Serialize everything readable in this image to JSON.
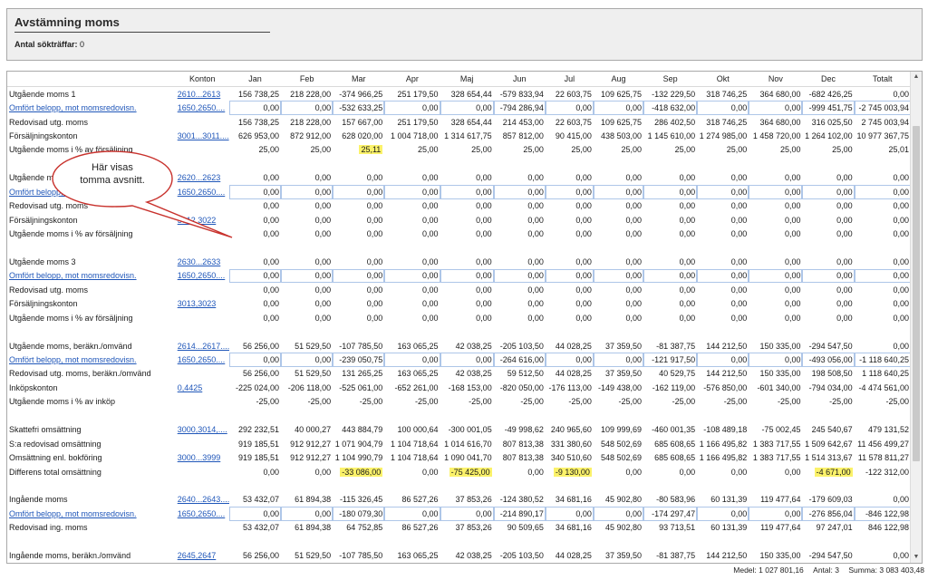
{
  "header": {
    "title": "Avstämning moms",
    "hits_label": "Antal sökträffar:",
    "hits_value": "0"
  },
  "columns": [
    "",
    "Konton",
    "Jan",
    "Feb",
    "Mar",
    "Apr",
    "Maj",
    "Jun",
    "Jul",
    "Aug",
    "Sep",
    "Okt",
    "Nov",
    "Dec",
    "Totalt"
  ],
  "rows": [
    {
      "label": "Utgående moms 1",
      "account": "2610...2613",
      "link": true,
      "values": [
        "156 738,25",
        "218 228,00",
        "-374 966,25",
        "251 179,50",
        "328 654,44",
        "-579 833,94",
        "22 603,75",
        "109 625,75",
        "-132 229,50",
        "318 746,25",
        "364 680,00",
        "-682 426,25",
        "0,00"
      ]
    },
    {
      "label": "Omfört belopp, mot momsredovisn.",
      "labelLink": true,
      "account": "1650,2650....",
      "link": true,
      "boxed": true,
      "values": [
        "0,00",
        "0,00",
        "-532 633,25",
        "0,00",
        "0,00",
        "-794 286,94",
        "0,00",
        "0,00",
        "-418 632,00",
        "0,00",
        "0,00",
        "-999 451,75",
        "-2 745 003,94"
      ]
    },
    {
      "label": "Redovisad utg. moms",
      "account": "",
      "values": [
        "156 738,25",
        "218 228,00",
        "157 667,00",
        "251 179,50",
        "328 654,44",
        "214 453,00",
        "22 603,75",
        "109 625,75",
        "286 402,50",
        "318 746,25",
        "364 680,00",
        "316 025,50",
        "2 745 003,94"
      ]
    },
    {
      "label": "Försäljningskonton",
      "account": "3001...3011....",
      "link": true,
      "values": [
        "626 953,00",
        "872 912,00",
        "628 020,00",
        "1 004 718,00",
        "1 314 617,75",
        "857 812,00",
        "90 415,00",
        "438 503,00",
        "1 145 610,00",
        "1 274 985,00",
        "1 458 720,00",
        "1 264 102,00",
        "10 977 367,75"
      ]
    },
    {
      "label": "Utgående moms i % av försäljning",
      "account": "",
      "hl": [
        2
      ],
      "values": [
        "25,00",
        "25,00",
        "25,11",
        "25,00",
        "25,00",
        "25,00",
        "25,00",
        "25,00",
        "25,00",
        "25,00",
        "25,00",
        "25,00",
        "25,01"
      ]
    },
    {
      "blank": true
    },
    {
      "label": "Utgående moms 2",
      "account": "2620...2623",
      "link": true,
      "values": [
        "0,00",
        "0,00",
        "0,00",
        "0,00",
        "0,00",
        "0,00",
        "0,00",
        "0,00",
        "0,00",
        "0,00",
        "0,00",
        "0,00",
        "0,00"
      ]
    },
    {
      "label": "Omfört belopp, mot momsredovisn.",
      "labelLink": true,
      "account": "1650,2650....",
      "link": true,
      "boxed": true,
      "values": [
        "0,00",
        "0,00",
        "0,00",
        "0,00",
        "0,00",
        "0,00",
        "0,00",
        "0,00",
        "0,00",
        "0,00",
        "0,00",
        "0,00",
        "0,00"
      ]
    },
    {
      "label": "Redovisad utg. moms",
      "account": "",
      "values": [
        "0,00",
        "0,00",
        "0,00",
        "0,00",
        "0,00",
        "0,00",
        "0,00",
        "0,00",
        "0,00",
        "0,00",
        "0,00",
        "0,00",
        "0,00"
      ]
    },
    {
      "label": "Försäljningskonton",
      "account": "3012,3022",
      "link": true,
      "values": [
        "0,00",
        "0,00",
        "0,00",
        "0,00",
        "0,00",
        "0,00",
        "0,00",
        "0,00",
        "0,00",
        "0,00",
        "0,00",
        "0,00",
        "0,00"
      ]
    },
    {
      "label": "Utgående moms i % av försäljning",
      "account": "",
      "values": [
        "0,00",
        "0,00",
        "0,00",
        "0,00",
        "0,00",
        "0,00",
        "0,00",
        "0,00",
        "0,00",
        "0,00",
        "0,00",
        "0,00",
        "0,00"
      ]
    },
    {
      "blank": true
    },
    {
      "label": "Utgående moms 3",
      "account": "2630...2633",
      "link": true,
      "values": [
        "0,00",
        "0,00",
        "0,00",
        "0,00",
        "0,00",
        "0,00",
        "0,00",
        "0,00",
        "0,00",
        "0,00",
        "0,00",
        "0,00",
        "0,00"
      ]
    },
    {
      "label": "Omfört belopp, mot momsredovisn.",
      "labelLink": true,
      "account": "1650,2650....",
      "link": true,
      "boxed": true,
      "values": [
        "0,00",
        "0,00",
        "0,00",
        "0,00",
        "0,00",
        "0,00",
        "0,00",
        "0,00",
        "0,00",
        "0,00",
        "0,00",
        "0,00",
        "0,00"
      ]
    },
    {
      "label": "Redovisad utg. moms",
      "account": "",
      "values": [
        "0,00",
        "0,00",
        "0,00",
        "0,00",
        "0,00",
        "0,00",
        "0,00",
        "0,00",
        "0,00",
        "0,00",
        "0,00",
        "0,00",
        "0,00"
      ]
    },
    {
      "label": "Försäljningskonton",
      "account": "3013,3023",
      "link": true,
      "values": [
        "0,00",
        "0,00",
        "0,00",
        "0,00",
        "0,00",
        "0,00",
        "0,00",
        "0,00",
        "0,00",
        "0,00",
        "0,00",
        "0,00",
        "0,00"
      ]
    },
    {
      "label": "Utgående moms i % av försäljning",
      "account": "",
      "values": [
        "0,00",
        "0,00",
        "0,00",
        "0,00",
        "0,00",
        "0,00",
        "0,00",
        "0,00",
        "0,00",
        "0,00",
        "0,00",
        "0,00",
        "0,00"
      ]
    },
    {
      "blank": true
    },
    {
      "label": "Utgående moms, beräkn./omvänd",
      "account": "2614...2617....",
      "link": true,
      "values": [
        "56 256,00",
        "51 529,50",
        "-107 785,50",
        "163 065,25",
        "42 038,25",
        "-205 103,50",
        "44 028,25",
        "37 359,50",
        "-81 387,75",
        "144 212,50",
        "150 335,00",
        "-294 547,50",
        "0,00"
      ]
    },
    {
      "label": "Omfört belopp, mot momsredovisn.",
      "labelLink": true,
      "account": "1650,2650....",
      "link": true,
      "boxed": true,
      "values": [
        "0,00",
        "0,00",
        "-239 050,75",
        "0,00",
        "0,00",
        "-264 616,00",
        "0,00",
        "0,00",
        "-121 917,50",
        "0,00",
        "0,00",
        "-493 056,00",
        "-1 118 640,25"
      ]
    },
    {
      "label": "Redovisad utg. moms, beräkn./omvänd",
      "account": "",
      "values": [
        "56 256,00",
        "51 529,50",
        "131 265,25",
        "163 065,25",
        "42 038,25",
        "59 512,50",
        "44 028,25",
        "37 359,50",
        "40 529,75",
        "144 212,50",
        "150 335,00",
        "198 508,50",
        "1 118 640,25"
      ]
    },
    {
      "label": "Inköpskonton",
      "account": "0,4425",
      "link": true,
      "values": [
        "-225 024,00",
        "-206 118,00",
        "-525 061,00",
        "-652 261,00",
        "-168 153,00",
        "-820 050,00",
        "-176 113,00",
        "-149 438,00",
        "-162 119,00",
        "-576 850,00",
        "-601 340,00",
        "-794 034,00",
        "-4 474 561,00"
      ]
    },
    {
      "label": "Utgående moms i % av inköp",
      "account": "",
      "values": [
        "-25,00",
        "-25,00",
        "-25,00",
        "-25,00",
        "-25,00",
        "-25,00",
        "-25,00",
        "-25,00",
        "-25,00",
        "-25,00",
        "-25,00",
        "-25,00",
        "-25,00"
      ]
    },
    {
      "blank": true
    },
    {
      "label": "Skattefri omsättning",
      "account": "3000,3014,....",
      "link": true,
      "values": [
        "292 232,51",
        "40 000,27",
        "443 884,79",
        "100 000,64",
        "-300 001,05",
        "-49 998,62",
        "240 965,60",
        "109 999,69",
        "-460 001,35",
        "-108 489,18",
        "-75 002,45",
        "245 540,67",
        "479 131,52"
      ]
    },
    {
      "label": "S:a redovisad omsättning",
      "account": "",
      "values": [
        "919 185,51",
        "912 912,27",
        "1 071 904,79",
        "1 104 718,64",
        "1 014 616,70",
        "807 813,38",
        "331 380,60",
        "548 502,69",
        "685 608,65",
        "1 166 495,82",
        "1 383 717,55",
        "1 509 642,67",
        "11 456 499,27"
      ]
    },
    {
      "label": "Omsättning enl. bokföring",
      "account": "3000...3999",
      "link": true,
      "values": [
        "919 185,51",
        "912 912,27",
        "1 104 990,79",
        "1 104 718,64",
        "1 090 041,70",
        "807 813,38",
        "340 510,60",
        "548 502,69",
        "685 608,65",
        "1 166 495,82",
        "1 383 717,55",
        "1 514 313,67",
        "11 578 811,27"
      ]
    },
    {
      "label": "Differens total omsättning",
      "account": "",
      "hl": [
        2,
        4,
        6,
        11
      ],
      "values": [
        "0,00",
        "0,00",
        "-33 086,00",
        "0,00",
        "-75 425,00",
        "0,00",
        "-9 130,00",
        "0,00",
        "0,00",
        "0,00",
        "0,00",
        "-4 671,00",
        "-122 312,00"
      ]
    },
    {
      "blank": true
    },
    {
      "label": "Ingående moms",
      "account": "2640...2643....",
      "link": true,
      "values": [
        "53 432,07",
        "61 894,38",
        "-115 326,45",
        "86 527,26",
        "37 853,26",
        "-124 380,52",
        "34 681,16",
        "45 902,80",
        "-80 583,96",
        "60 131,39",
        "119 477,64",
        "-179 609,03",
        "0,00"
      ]
    },
    {
      "label": "Omfört belopp, mot momsredovisn.",
      "labelLink": true,
      "account": "1650,2650....",
      "link": true,
      "boxed": true,
      "values": [
        "0,00",
        "0,00",
        "-180 079,30",
        "0,00",
        "0,00",
        "-214 890,17",
        "0,00",
        "0,00",
        "-174 297,47",
        "0,00",
        "0,00",
        "-276 856,04",
        "-846 122,98"
      ]
    },
    {
      "label": "Redovisad ing. moms",
      "account": "",
      "values": [
        "53 432,07",
        "61 894,38",
        "64 752,85",
        "86 527,26",
        "37 853,26",
        "90 509,65",
        "34 681,16",
        "45 902,80",
        "93 713,51",
        "60 131,39",
        "119 477,64",
        "97 247,01",
        "846 122,98"
      ]
    },
    {
      "blank": true
    },
    {
      "label": "Ingående moms, beräkn./omvänd",
      "account": "2645,2647",
      "link": true,
      "values": [
        "56 256,00",
        "51 529,50",
        "-107 785,50",
        "163 065,25",
        "42 038,25",
        "-205 103,50",
        "44 028,25",
        "37 359,50",
        "-81 387,75",
        "144 212,50",
        "150 335,00",
        "-294 547,50",
        "0,00"
      ]
    }
  ],
  "callout": {
    "line1": "Här visas",
    "line2": "tomma avsnitt."
  },
  "status": {
    "medel": "Medel: 1 027 801,16",
    "antal": "Antal: 3",
    "summa": "Summa: 3 083 403,48"
  },
  "colors": {
    "link": "#1f56b9",
    "highlight": "#fbf26a",
    "panel": "#efefef"
  }
}
